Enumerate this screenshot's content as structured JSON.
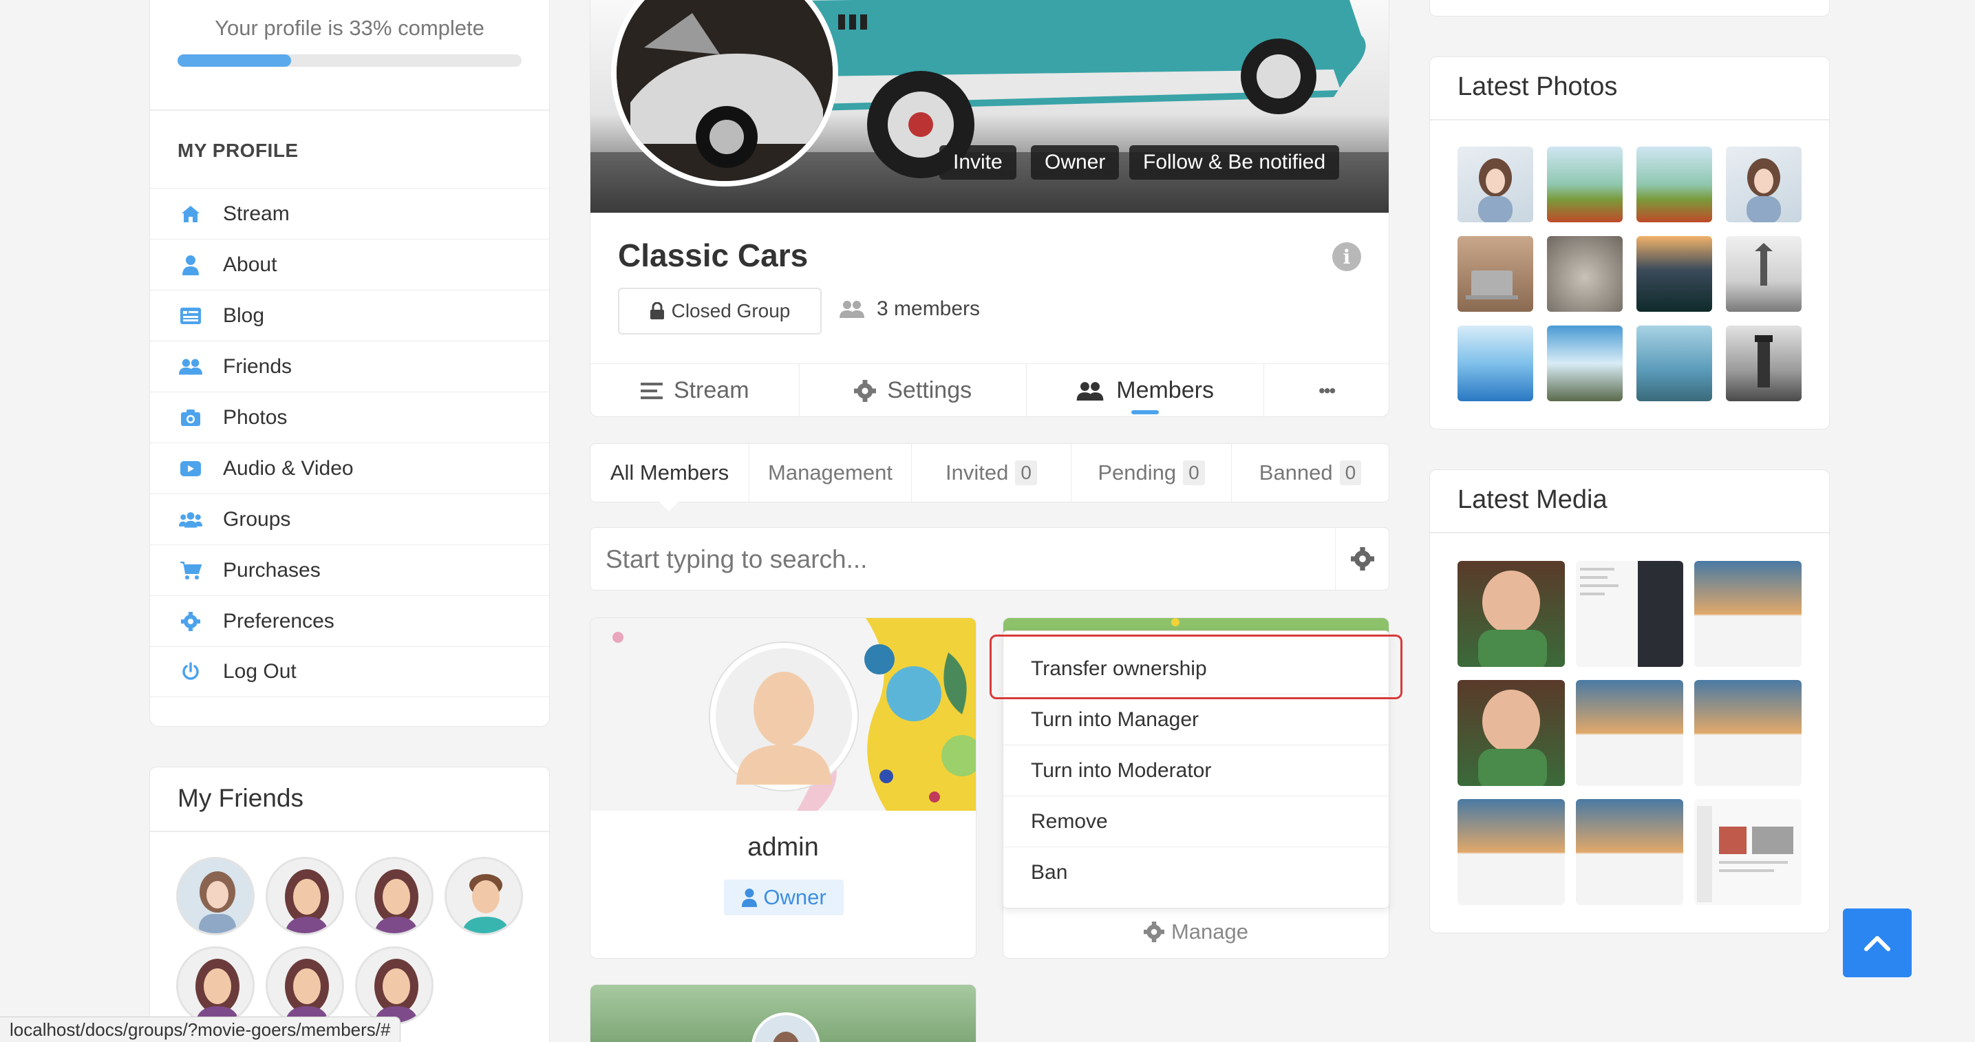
{
  "profile": {
    "completion_text": "Your profile is 33% complete",
    "completion_percent": 33,
    "section_title": "MY PROFILE",
    "menu": [
      {
        "label": "Stream",
        "icon": "home-icon"
      },
      {
        "label": "About",
        "icon": "user-icon"
      },
      {
        "label": "Blog",
        "icon": "blog-icon"
      },
      {
        "label": "Friends",
        "icon": "friends-icon"
      },
      {
        "label": "Photos",
        "icon": "camera-icon"
      },
      {
        "label": "Audio & Video",
        "icon": "video-icon"
      },
      {
        "label": "Groups",
        "icon": "groups-icon"
      },
      {
        "label": "Purchases",
        "icon": "cart-icon"
      },
      {
        "label": "Preferences",
        "icon": "gear-icon"
      },
      {
        "label": "Log Out",
        "icon": "power-icon"
      }
    ]
  },
  "friends": {
    "title": "My Friends"
  },
  "group": {
    "cover_buttons": {
      "invite": "Invite",
      "owner": "Owner",
      "follow": "Follow & Be notified"
    },
    "title": "Classic Cars",
    "privacy": "Closed Group",
    "members_count": "3 members",
    "tabs": [
      {
        "label": "Stream",
        "icon": "list-icon"
      },
      {
        "label": "Settings",
        "icon": "gear-icon"
      },
      {
        "label": "Members",
        "icon": "users-icon"
      },
      {
        "label": "•••",
        "icon": "more-icon"
      }
    ],
    "active_tab": "Members"
  },
  "member_tabs": {
    "all": "All Members",
    "management": "Management",
    "invited": "Invited",
    "invited_count": "0",
    "pending": "Pending",
    "pending_count": "0",
    "banned": "Banned",
    "banned_count": "0"
  },
  "search": {
    "placeholder": "Start typing to search..."
  },
  "member_card": {
    "name": "admin",
    "role": "Owner"
  },
  "manage_label": "Manage",
  "dropdown": {
    "items": [
      "Transfer ownership",
      "Turn into Manager",
      "Turn into Moderator",
      "Remove",
      "Ban"
    ]
  },
  "latest_photos": {
    "title": "Latest Photos"
  },
  "latest_media": {
    "title": "Latest Media"
  },
  "status_url": "localhost/docs/groups/?movie-goers/members/#",
  "colors": {
    "accent": "#4ca3ec",
    "highlight": "#d83a3a",
    "scroll_button": "#2c86f2"
  }
}
